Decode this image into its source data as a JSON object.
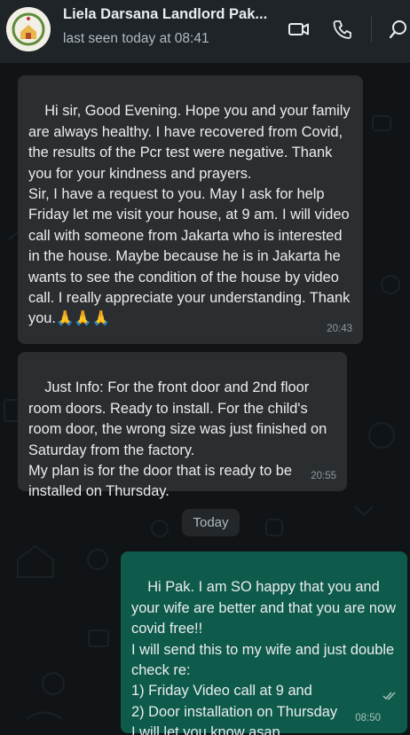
{
  "header": {
    "contact_name": "Liela Darsana Landlord Pak...",
    "status": "last seen today at 08:41",
    "actions": [
      "video-call-icon",
      "voice-call-icon",
      "search-icon"
    ]
  },
  "messages": [
    {
      "direction": "incoming",
      "text": "Hi sir, Good Evening. Hope you and your family are always healthy. I have recovered from Covid, the results of the Pcr test were negative. Thank you for your kindness and prayers.\nSir, I have a request to you. May I ask for help Friday let me visit your house, at 9 am. I will video call with someone from Jakarta who is interested in the house. Maybe because he is in Jakarta he wants to see the condition of the house by video call. I really appreciate your understanding. Thank you.🙏🙏🙏",
      "time": "20:43"
    },
    {
      "direction": "incoming",
      "text": "Just Info: For the front door and 2nd floor room doors. Ready to install. For the child's room door, the wrong size was just finished on Saturday from the factory.\nMy plan is for the door that is ready to be installed on Thursday.",
      "time": "20:55"
    },
    {
      "direction": "outgoing",
      "text": "Hi Pak. I am SO happy that you and your wife are better and that you are now covid free!!\nI will send this to my wife and just double check re:\n1) Friday Video call at 9 and\n2) Door installation on Thursday\nI will let you know asap.",
      "time": "08:50",
      "status": "delivered"
    }
  ],
  "date_separator": "Today",
  "colors": {
    "header_bg": "#1f2428",
    "chat_bg": "#101417",
    "incoming_bubble": "#2b2e30",
    "outgoing_bubble": "#0f5b4b",
    "text": "#e9edef"
  }
}
